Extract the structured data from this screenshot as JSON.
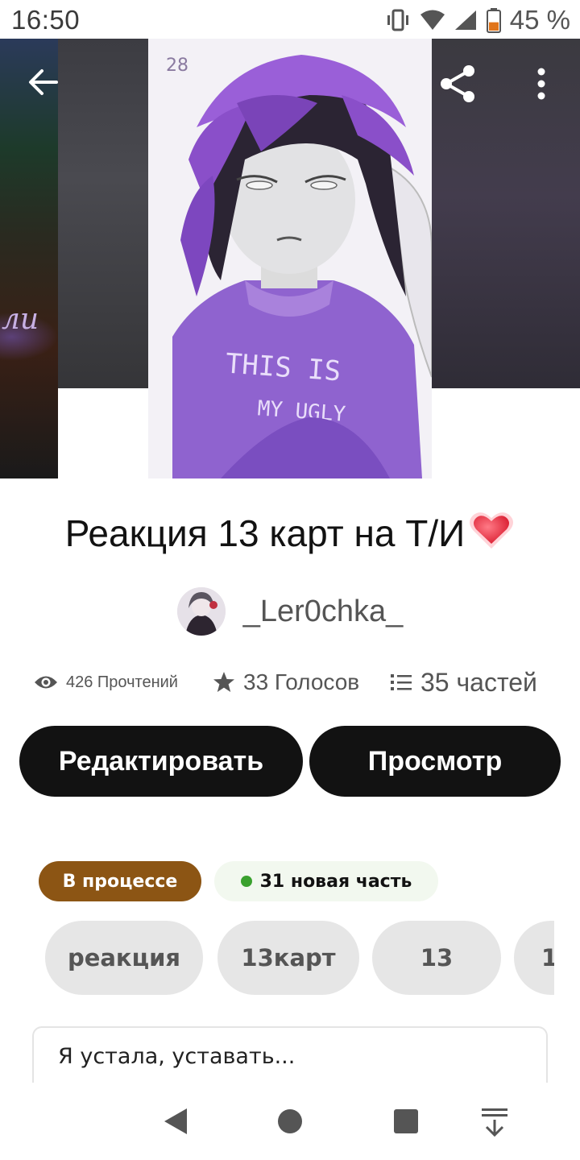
{
  "status_bar": {
    "time": "16:50",
    "battery_percent": "45 %",
    "battery_level": 0.45
  },
  "hero": {
    "left_cover_text": "лu",
    "cover_shirt_line1": "THIS IS",
    "cover_shirt_line2": "MY UGLY",
    "cover_corner_text": "28"
  },
  "story": {
    "title": "Реакция 13 карт на Т/И",
    "title_emoji": "heart-icon"
  },
  "author": {
    "name": "_Ler0chka_"
  },
  "stats": {
    "reads": "426 Прочтений",
    "votes": "33 Голосов",
    "parts": "35 частей"
  },
  "actions": {
    "edit_label": "Редактировать",
    "view_label": "Просмотр"
  },
  "badges": {
    "status": "В процессе",
    "new_parts": "31 новая часть"
  },
  "tags": [
    "реакция",
    "13карт",
    "13",
    "1"
  ],
  "description": {
    "text": "Я устала, уставать..."
  },
  "colors": {
    "accent_dark": "#121212",
    "status_brown": "#8c5514",
    "new_green": "#3aa12e",
    "tag_bg": "#e6e6e6"
  }
}
